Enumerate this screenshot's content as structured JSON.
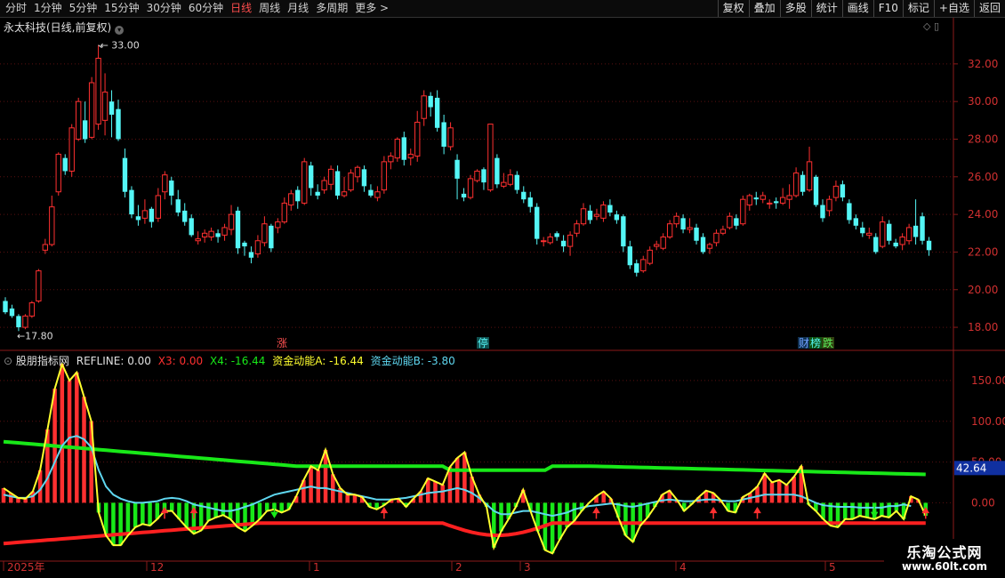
{
  "toolbar": {
    "periods": [
      "分时",
      "1分钟",
      "5分钟",
      "15分钟",
      "30分钟",
      "60分钟",
      "日线",
      "周线",
      "月线",
      "多周期",
      "更多 >"
    ],
    "active_period": "日线",
    "actions": [
      "复权",
      "叠加",
      "多股",
      "统计",
      "画线",
      "F10",
      "标记",
      "+自选",
      "返回"
    ]
  },
  "main": {
    "title": "永太科技(日线,前复权)",
    "y_ticks": [
      "32.00",
      "30.00",
      "28.00",
      "26.00",
      "24.00",
      "22.00",
      "20.00",
      "18.00"
    ],
    "high_label": "33.00",
    "low_label": "17.80",
    "marker_zhang": "涨",
    "marker_ting": "停",
    "marker_cai": "财",
    "marker_bang": "榜",
    "marker_die": "跌"
  },
  "indicator": {
    "name": "股朋指标网",
    "refline": "REFLINE: 0.00",
    "x3": "X3: 0.00",
    "x4": "X4: -16.44",
    "fund_a": "资金动能A: -16.44",
    "fund_b": "资金动能B: -3.80",
    "y_ticks": [
      "150.00",
      "100.00",
      "50.00",
      "0.00"
    ],
    "current_value": "42.64"
  },
  "date_axis": [
    "2025年",
    "12",
    "1",
    "2",
    "3",
    "4",
    "5"
  ],
  "watermark": {
    "line1": "乐淘公式网",
    "line2": "www.60lt.com"
  },
  "colors": {
    "up": "#ff3030",
    "down": "#54f6f6",
    "green": "#18e818",
    "yellow": "#ffff2e",
    "cyan": "#5fd7f0"
  },
  "chart_data": {
    "type": "candlestick",
    "y_range": [
      17.2,
      33.6
    ],
    "candles": [
      [
        19.4,
        18.8,
        19.6,
        18.7
      ],
      [
        19.0,
        18.6,
        19.2,
        18.5
      ],
      [
        18.6,
        18.0,
        18.7,
        17.8
      ],
      [
        18.0,
        18.6,
        18.7,
        17.9
      ],
      [
        18.6,
        19.3,
        19.4,
        18.5
      ],
      [
        19.4,
        21.0,
        21.1,
        19.3
      ],
      [
        22.1,
        22.4,
        22.7,
        21.9
      ],
      [
        22.4,
        24.4,
        25.0,
        22.3
      ],
      [
        25.2,
        27.2,
        27.3,
        25.0
      ],
      [
        27.0,
        26.3,
        27.2,
        26.1
      ],
      [
        26.3,
        28.6,
        28.8,
        26.0
      ],
      [
        28.0,
        30.0,
        30.2,
        27.9
      ],
      [
        29.0,
        28.0,
        30.0,
        27.8
      ],
      [
        28.1,
        31.0,
        31.3,
        28.0
      ],
      [
        28.8,
        32.3,
        33.0,
        28.5
      ],
      [
        29.0,
        30.5,
        31.5,
        28.2
      ],
      [
        30.0,
        29.3,
        30.6,
        28.1
      ],
      [
        29.6,
        28.0,
        30.1,
        27.9
      ],
      [
        27.0,
        25.2,
        27.5,
        24.9
      ],
      [
        25.3,
        24.0,
        25.5,
        23.8
      ],
      [
        23.9,
        23.7,
        24.5,
        23.4
      ],
      [
        23.8,
        24.2,
        24.8,
        23.5
      ],
      [
        24.3,
        23.6,
        24.4,
        23.3
      ],
      [
        23.8,
        25.0,
        25.4,
        23.6
      ],
      [
        25.2,
        26.1,
        26.3,
        24.8
      ],
      [
        25.8,
        25.0,
        26.0,
        24.5
      ],
      [
        24.8,
        24.1,
        25.3,
        23.9
      ],
      [
        24.2,
        23.6,
        24.6,
        23.4
      ],
      [
        23.8,
        22.9,
        24.0,
        22.8
      ],
      [
        22.6,
        22.7,
        23.1,
        22.4
      ],
      [
        22.8,
        23.0,
        23.2,
        22.5
      ],
      [
        22.8,
        23.1,
        23.3,
        22.6
      ],
      [
        23.0,
        22.8,
        23.2,
        22.5
      ],
      [
        22.9,
        23.3,
        23.5,
        22.6
      ],
      [
        23.2,
        24.0,
        24.5,
        22.9
      ],
      [
        24.2,
        22.2,
        24.4,
        21.9
      ],
      [
        22.5,
        22.3,
        22.6,
        21.8
      ],
      [
        22.0,
        21.7,
        22.3,
        21.4
      ],
      [
        21.9,
        22.6,
        22.9,
        21.7
      ],
      [
        22.5,
        23.5,
        23.9,
        22.3
      ],
      [
        23.4,
        22.2,
        23.5,
        22.0
      ],
      [
        23.3,
        23.6,
        23.8,
        23.0
      ],
      [
        23.6,
        24.6,
        24.9,
        23.5
      ],
      [
        24.5,
        25.1,
        25.3,
        24.2
      ],
      [
        25.3,
        24.7,
        25.5,
        24.3
      ],
      [
        24.6,
        26.8,
        27.0,
        24.5
      ],
      [
        26.6,
        25.4,
        26.8,
        25.0
      ],
      [
        25.2,
        25.0,
        25.6,
        24.8
      ],
      [
        25.3,
        25.8,
        26.0,
        25.1
      ],
      [
        25.6,
        26.4,
        26.6,
        25.3
      ],
      [
        26.3,
        25.0,
        26.6,
        24.8
      ],
      [
        25.0,
        25.2,
        26.0,
        24.9
      ],
      [
        25.3,
        26.2,
        26.4,
        25.2
      ],
      [
        26.0,
        26.5,
        26.6,
        25.7
      ],
      [
        26.4,
        25.5,
        26.6,
        25.2
      ],
      [
        25.3,
        25.0,
        25.6,
        24.9
      ],
      [
        24.9,
        25.2,
        25.5,
        24.7
      ],
      [
        25.3,
        26.8,
        27.1,
        25.1
      ],
      [
        26.8,
        27.1,
        27.3,
        26.4
      ],
      [
        27.0,
        28.0,
        28.1,
        26.8
      ],
      [
        28.1,
        26.9,
        28.4,
        26.6
      ],
      [
        27.0,
        27.2,
        27.5,
        26.6
      ],
      [
        27.1,
        28.9,
        29.5,
        26.8
      ],
      [
        29.1,
        30.3,
        30.6,
        28.7
      ],
      [
        30.3,
        29.7,
        30.5,
        29.2
      ],
      [
        30.2,
        28.6,
        30.6,
        28.4
      ],
      [
        28.9,
        27.6,
        29.3,
        27.2
      ],
      [
        27.6,
        28.6,
        28.9,
        27.4
      ],
      [
        26.9,
        25.9,
        27.2,
        24.8
      ],
      [
        25.1,
        24.9,
        25.4,
        24.7
      ],
      [
        24.9,
        25.9,
        26.1,
        24.8
      ],
      [
        25.8,
        26.3,
        26.4,
        25.7
      ],
      [
        26.4,
        25.7,
        26.5,
        25.3
      ],
      [
        25.3,
        28.8,
        28.8,
        25.2
      ],
      [
        27.0,
        25.6,
        27.2,
        25.4
      ],
      [
        25.5,
        25.7,
        26.2,
        25.4
      ],
      [
        25.6,
        26.1,
        26.4,
        25.5
      ],
      [
        26.1,
        25.3,
        26.3,
        25.1
      ],
      [
        25.2,
        24.8,
        25.5,
        24.6
      ],
      [
        24.9,
        24.4,
        25.2,
        24.1
      ],
      [
        24.4,
        22.7,
        24.6,
        22.4
      ],
      [
        22.6,
        22.6,
        22.8,
        22.3
      ],
      [
        22.5,
        22.8,
        23.0,
        22.4
      ],
      [
        23.0,
        22.8,
        23.1,
        22.6
      ],
      [
        22.6,
        22.3,
        22.9,
        22.0
      ],
      [
        22.3,
        22.9,
        23.1,
        21.8
      ],
      [
        23.0,
        23.5,
        23.7,
        22.8
      ],
      [
        23.5,
        24.3,
        24.6,
        23.4
      ],
      [
        24.2,
        23.7,
        24.5,
        23.5
      ],
      [
        23.9,
        24.0,
        24.3,
        23.7
      ],
      [
        23.8,
        24.5,
        24.7,
        23.6
      ],
      [
        24.5,
        24.1,
        24.8,
        23.9
      ],
      [
        24.0,
        23.7,
        24.2,
        23.5
      ],
      [
        23.9,
        22.3,
        24.0,
        22.0
      ],
      [
        22.3,
        21.3,
        22.6,
        21.1
      ],
      [
        21.4,
        20.9,
        21.6,
        20.7
      ],
      [
        21.0,
        21.6,
        21.8,
        20.9
      ],
      [
        21.4,
        22.1,
        22.3,
        21.3
      ],
      [
        22.3,
        22.4,
        22.6,
        22.1
      ],
      [
        22.2,
        22.8,
        23.0,
        22.1
      ],
      [
        22.8,
        23.5,
        23.7,
        22.7
      ],
      [
        23.5,
        23.9,
        24.1,
        23.3
      ],
      [
        23.8,
        23.2,
        24.0,
        23.0
      ],
      [
        23.2,
        23.3,
        23.8,
        23.0
      ],
      [
        23.3,
        22.6,
        23.5,
        22.4
      ],
      [
        22.8,
        22.0,
        23.0,
        21.9
      ],
      [
        22.2,
        22.4,
        22.5,
        21.9
      ],
      [
        22.5,
        23.0,
        23.2,
        22.3
      ],
      [
        23.0,
        23.2,
        23.4,
        22.9
      ],
      [
        23.3,
        23.9,
        24.1,
        23.2
      ],
      [
        23.8,
        23.4,
        24.0,
        23.2
      ],
      [
        23.5,
        24.8,
        25.0,
        23.4
      ],
      [
        24.5,
        25.0,
        25.1,
        24.2
      ],
      [
        24.9,
        24.8,
        25.2,
        24.5
      ],
      [
        24.8,
        25.0,
        25.2,
        24.6
      ],
      [
        24.6,
        24.6,
        24.8,
        24.3
      ],
      [
        24.7,
        24.6,
        24.9,
        24.3
      ],
      [
        24.6,
        24.9,
        25.4,
        24.5
      ],
      [
        24.8,
        25.0,
        25.6,
        24.3
      ],
      [
        25.0,
        26.2,
        26.5,
        24.9
      ],
      [
        26.1,
        25.2,
        26.3,
        25.0
      ],
      [
        25.3,
        26.8,
        27.6,
        25.2
      ],
      [
        26.0,
        24.5,
        26.1,
        24.4
      ],
      [
        24.5,
        23.8,
        24.8,
        23.6
      ],
      [
        24.2,
        24.8,
        25.0,
        23.9
      ],
      [
        24.9,
        25.5,
        25.8,
        24.7
      ],
      [
        25.6,
        24.9,
        25.8,
        24.7
      ],
      [
        24.6,
        23.7,
        24.8,
        23.5
      ],
      [
        23.8,
        23.4,
        24.0,
        23.2
      ],
      [
        23.3,
        23.0,
        23.6,
        22.8
      ],
      [
        22.9,
        23.0,
        23.3,
        22.7
      ],
      [
        22.8,
        22.0,
        23.0,
        21.9
      ],
      [
        22.3,
        23.6,
        23.9,
        22.2
      ],
      [
        23.5,
        22.6,
        23.7,
        22.4
      ],
      [
        22.5,
        22.3,
        22.7,
        22.2
      ],
      [
        22.4,
        22.8,
        23.0,
        22.1
      ],
      [
        22.6,
        23.3,
        23.5,
        22.4
      ],
      [
        23.4,
        22.8,
        24.8,
        22.4
      ],
      [
        23.9,
        22.6,
        24.1,
        22.4
      ],
      [
        22.6,
        22.1,
        22.8,
        21.8
      ]
    ],
    "indicator": {
      "zero": 0,
      "y_range": [
        -65,
        175
      ],
      "fund": [
        18,
        12,
        6,
        5,
        14,
        40,
        90,
        140,
        170,
        150,
        160,
        130,
        100,
        -12,
        -40,
        -52,
        -52,
        -40,
        -30,
        -26,
        -28,
        -20,
        -10,
        -10,
        -20,
        -30,
        -38,
        -34,
        -22,
        -18,
        -15,
        -20,
        -30,
        -35,
        -28,
        -20,
        -10,
        -8,
        -12,
        -8,
        8,
        28,
        45,
        40,
        65,
        35,
        18,
        10,
        10,
        7,
        -5,
        -8,
        -3,
        4,
        5,
        -5,
        5,
        14,
        30,
        26,
        22,
        44,
        55,
        62,
        32,
        10,
        -5,
        -55,
        -35,
        -20,
        -5,
        16,
        -10,
        -35,
        -58,
        -62,
        -45,
        -30,
        -22,
        -10,
        0,
        8,
        14,
        5,
        -18,
        -40,
        -48,
        -28,
        -18,
        -5,
        10,
        15,
        4,
        -10,
        -2,
        7,
        15,
        12,
        3,
        -10,
        -12,
        7,
        12,
        20,
        36,
        25,
        28,
        22,
        32,
        45,
        -2,
        -10,
        -20,
        -28,
        -30,
        -20,
        -20,
        -16,
        -18,
        -20,
        -16,
        -18,
        -10,
        -20,
        8,
        4,
        -16
      ],
      "fund_b": [
        10,
        8,
        6,
        6,
        8,
        16,
        30,
        50,
        70,
        80,
        82,
        78,
        68,
        40,
        20,
        10,
        5,
        2,
        0,
        0,
        1,
        2,
        5,
        6,
        5,
        2,
        -2,
        -4,
        -6,
        -8,
        -10,
        -10,
        -8,
        -5,
        -2,
        2,
        6,
        10,
        12,
        14,
        16,
        18,
        20,
        18,
        18,
        16,
        14,
        12,
        10,
        8,
        6,
        4,
        4,
        4,
        5,
        6,
        8,
        10,
        12,
        13,
        14,
        16,
        18,
        16,
        12,
        6,
        -2,
        -10,
        -14,
        -14,
        -12,
        -10,
        -10,
        -12,
        -14,
        -16,
        -14,
        -12,
        -8,
        -6,
        -4,
        -3,
        -2,
        -1,
        -2,
        -4,
        -5,
        -3,
        -1,
        1,
        3,
        4,
        3,
        2,
        2,
        3,
        4,
        4,
        3,
        2,
        2,
        4,
        6,
        8,
        10,
        10,
        10,
        10,
        10,
        8,
        4,
        0,
        -3,
        -4,
        -5,
        -5,
        -5,
        -6,
        -6,
        -6,
        -6,
        -4,
        -4,
        -2,
        -4
      ]
    }
  }
}
